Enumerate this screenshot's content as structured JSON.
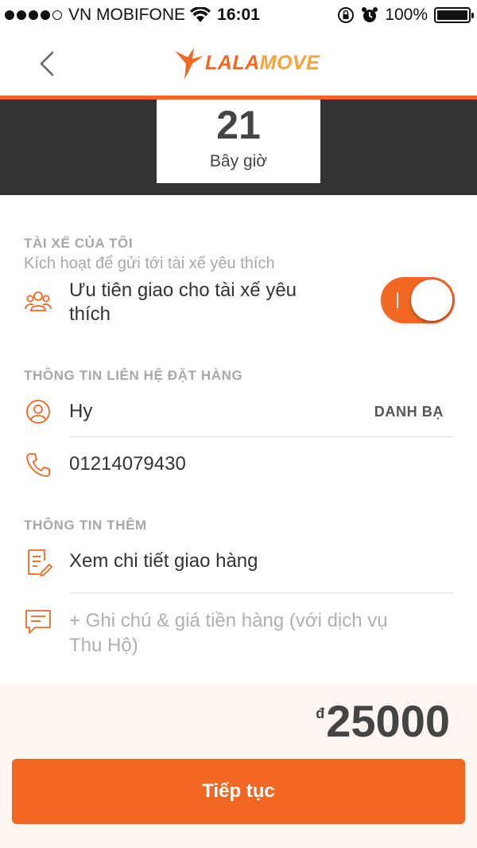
{
  "status_bar": {
    "carrier": "VN MOBIFONE",
    "time": "16:01",
    "battery": "100%"
  },
  "nav": {
    "logo_text": "LALAMOVE"
  },
  "schedule": {
    "number": "21",
    "label": "Bây giờ"
  },
  "favorite_driver": {
    "section_title": "TÀI XẾ CỦA TÔI",
    "subtitle": "Kích hoạt để gửi tới tài xế yêu thích",
    "option_label_line1": "Ưu tiên giao cho tài xế yêu",
    "option_label_line2": "thích",
    "toggle_on": true
  },
  "contact": {
    "section_title": "THÔNG TIN LIÊN HỆ ĐẶT HÀNG",
    "name": "Hy",
    "contacts_link": "DANH BẠ",
    "phone": "01214079430"
  },
  "extra": {
    "section_title": "THÔNG TIN THÊM",
    "delivery_details": "Xem chi tiết giao hàng",
    "note_placeholder_line1": "+ Ghi chú & giá tiền hàng (với dịch vụ",
    "note_placeholder_line2": "Thu Hộ)"
  },
  "footer": {
    "currency": "đ",
    "price": "25000",
    "continue_label": "Tiếp tục"
  },
  "colors": {
    "accent": "#f26722",
    "dark_band": "#333333",
    "muted_text": "#a8a8a8"
  }
}
